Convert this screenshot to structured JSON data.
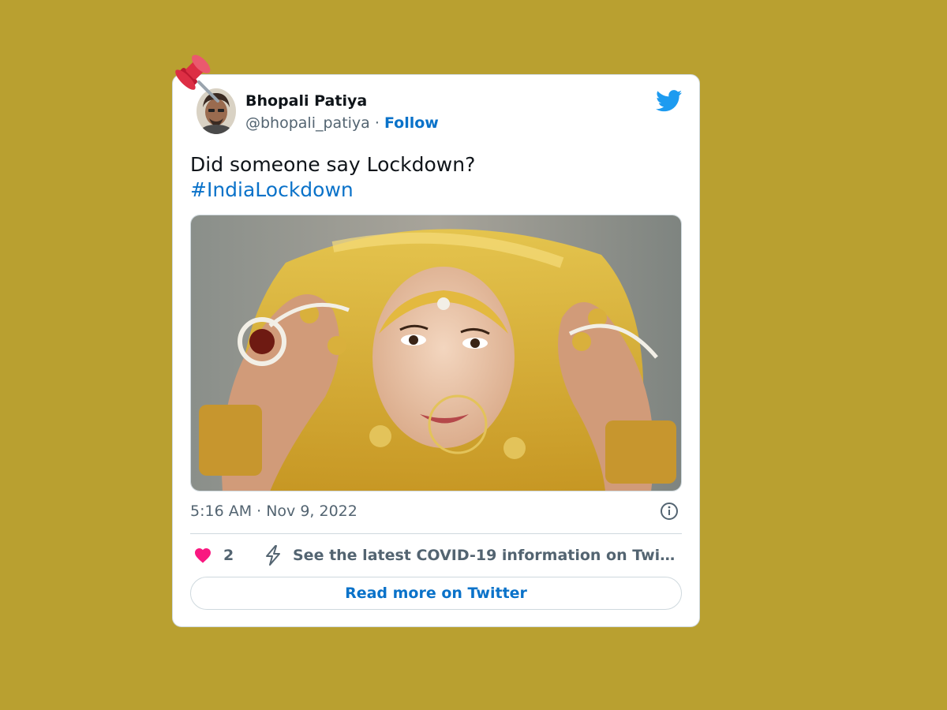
{
  "tweet": {
    "author_name": "Bhopali Patiya",
    "author_handle": "@bhopali_patiya",
    "separator": "·",
    "follow_label": "Follow",
    "text_line1": "Did someone say Lockdown?",
    "hashtag": "#IndiaLockdown",
    "timestamp": "5:16 AM · Nov 9, 2022",
    "like_count": "2",
    "covid_link": "See the latest COVID-19 information on Twitter",
    "read_more_label": "Read more on Twitter"
  },
  "icons": {
    "pin": "pushpin-icon",
    "logo": "twitter-bird-icon",
    "info": "info-icon",
    "like": "heart-icon",
    "covid": "lightning-icon"
  },
  "colors": {
    "background": "#B9A030",
    "link": "#0a72c9",
    "twitter_blue": "#1d9bf0",
    "like": "#f91880",
    "secondary_text": "#536471"
  }
}
